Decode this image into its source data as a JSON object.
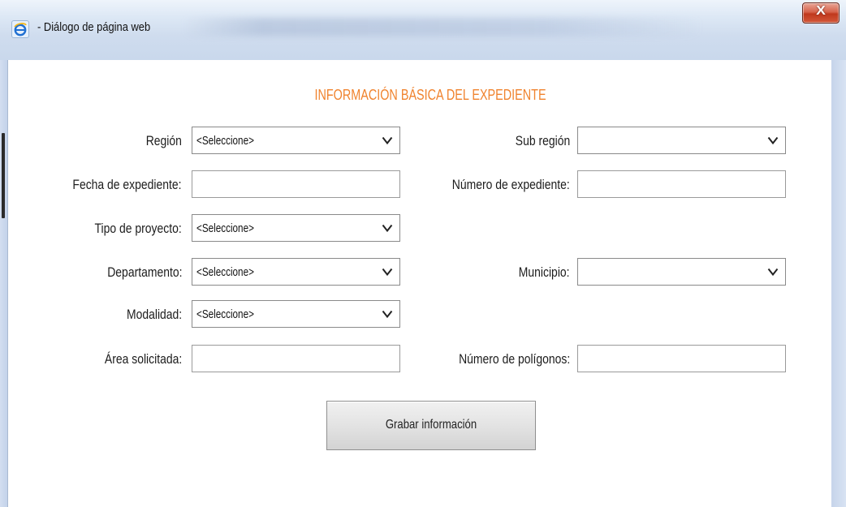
{
  "window": {
    "title": "- Diálogo de página web",
    "close_label": "X"
  },
  "form": {
    "title": "INFORMACIÓN BÁSICA DEL EXPEDIENTE",
    "region": {
      "label": "Región",
      "value": "<Seleccione>"
    },
    "sub_region": {
      "label": "Sub región",
      "value": ""
    },
    "fecha_expediente": {
      "label": "Fecha de expediente:",
      "value": ""
    },
    "numero_expediente": {
      "label": "Número de expediente:",
      "value": ""
    },
    "tipo_proyecto": {
      "label": "Tipo de proyecto:",
      "value": "<Seleccione>"
    },
    "departamento": {
      "label": "Departamento:",
      "value": "<Seleccione>"
    },
    "municipio": {
      "label": "Municipio:",
      "value": ""
    },
    "modalidad": {
      "label": "Modalidad:",
      "value": "<Seleccione>"
    },
    "area_solicitada": {
      "label": "Área solicitada:",
      "value": ""
    },
    "numero_poligonos": {
      "label": "Número de polígonos:",
      "value": ""
    },
    "save_label": "Grabar información"
  },
  "colors": {
    "title_accent": "#f0832e",
    "close_button": "#c7432a"
  },
  "icons": [
    "ie-browser-icon",
    "chevron-down-icon",
    "close-icon"
  ]
}
